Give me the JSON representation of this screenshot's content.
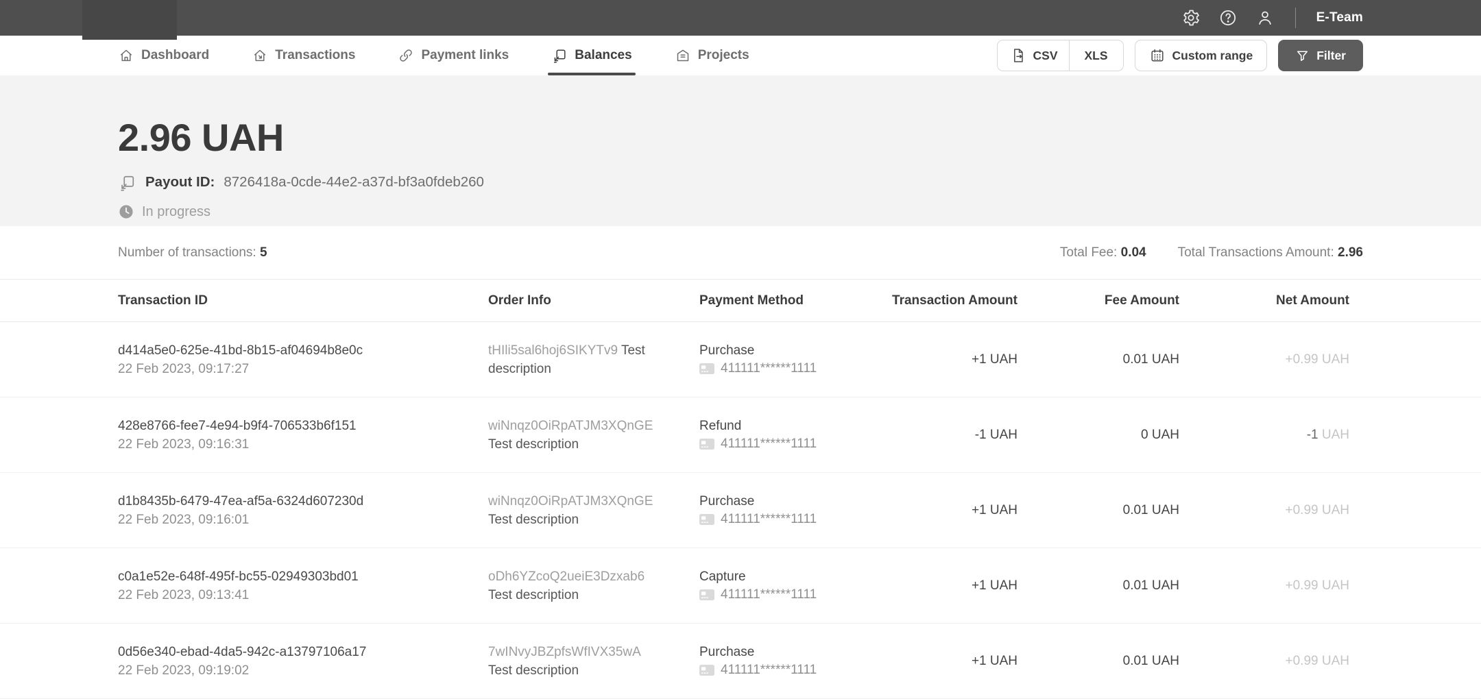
{
  "topbar": {
    "team_name": "E-Team"
  },
  "nav": {
    "tabs": [
      {
        "label": "Dashboard"
      },
      {
        "label": "Transactions"
      },
      {
        "label": "Payment links"
      },
      {
        "label": "Balances"
      },
      {
        "label": "Projects"
      }
    ],
    "active_tab": "Balances"
  },
  "toolbar": {
    "csv_label": "CSV",
    "xls_label": "XLS",
    "custom_range_label": "Custom range",
    "filter_label": "Filter"
  },
  "hero": {
    "amount": "2.96 UAH",
    "payout_label": "Payout ID:",
    "payout_id": "8726418a-0cde-44e2-a37d-bf3a0fdeb260",
    "status": "In progress"
  },
  "summary": {
    "transactions_label": "Number of transactions:",
    "transactions_count": "5",
    "fee_label": "Total Fee:",
    "fee_value": "0.04",
    "total_label": "Total Transactions Amount:",
    "total_value": "2.96"
  },
  "table": {
    "headers": [
      "Transaction ID",
      "Order Info",
      "Payment Method",
      "Transaction Amount",
      "Fee Amount",
      "Net Amount"
    ],
    "rows": [
      {
        "id": "d414a5e0-625e-41bd-8b15-af04694b8e0c",
        "date": "22 Feb 2023, 09:17:27",
        "order_id": "tHIli5sal6hoj6SIKYTv9",
        "order_description": "Test description",
        "method": "Purchase",
        "card": "411111******1111",
        "transaction_amount": "+1 UAH",
        "fee_amount": "0.01 UAH",
        "net_value": "+0.99",
        "net_currency": "UAH"
      },
      {
        "id": "428e8766-fee7-4e94-b9f4-706533b6f151",
        "date": "22 Feb 2023, 09:16:31",
        "order_id": "wiNnqz0OiRpATJM3XQnGE",
        "order_description": "Test description",
        "method": "Refund",
        "card": "411111******1111",
        "transaction_amount": "-1 UAH",
        "fee_amount": "0 UAH",
        "net_value": "-1",
        "net_currency": "UAH"
      },
      {
        "id": "d1b8435b-6479-47ea-af5a-6324d607230d",
        "date": "22 Feb 2023, 09:16:01",
        "order_id": "wiNnqz0OiRpATJM3XQnGE",
        "order_description": "Test description",
        "method": "Purchase",
        "card": "411111******1111",
        "transaction_amount": "+1 UAH",
        "fee_amount": "0.01 UAH",
        "net_value": "+0.99",
        "net_currency": "UAH"
      },
      {
        "id": "c0a1e52e-648f-495f-bc55-02949303bd01",
        "date": "22 Feb 2023, 09:13:41",
        "order_id": "oDh6YZcoQ2ueiE3Dzxab6",
        "order_description": "Test description",
        "method": "Capture",
        "card": "411111******1111",
        "transaction_amount": "+1 UAH",
        "fee_amount": "0.01 UAH",
        "net_value": "+0.99",
        "net_currency": "UAH"
      },
      {
        "id": "0d56e340-ebad-4da5-942c-a13797106a17",
        "date": "22 Feb 2023, 09:19:02",
        "order_id": "7wINvyJBZpfsWfIVX35wA",
        "order_description": "Test description",
        "method": "Purchase",
        "card": "411111******1111",
        "transaction_amount": "+1 UAH",
        "fee_amount": "0.01 UAH",
        "net_value": "+0.99",
        "net_currency": "UAH"
      }
    ]
  },
  "icons": {
    "settings-icon": "gear",
    "help-icon": "question-circle",
    "user-icon": "person",
    "dashboard-icon": "home",
    "transactions-icon": "home-arrow",
    "payment-links-icon": "chain-link",
    "balances-icon": "card-transfer",
    "projects-icon": "house-list",
    "export-icon": "file-arrow-right",
    "calendar-icon": "calendar",
    "filter-icon": "funnel",
    "payout-icon": "card-transfer",
    "status-icon": "clock-filled",
    "card-icon": "credit-card"
  },
  "colors": {
    "topbar_bg": "#4f4f4f",
    "logo_block_bg": "#474747",
    "hero_bg": "#f3f3f3",
    "filter_button_bg": "#5d5d5d",
    "active_tab_underline": "#4a4a4a",
    "text_primary": "#3e3e3e",
    "text_secondary": "#8f8f8f",
    "text_muted": "#c5c5c5",
    "divider": "#eaeaea"
  }
}
